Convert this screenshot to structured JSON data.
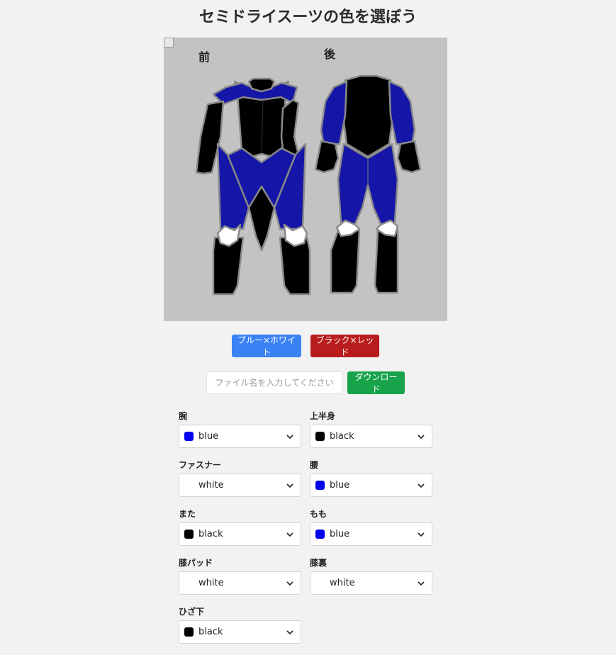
{
  "page": {
    "title": "セミドライスーツの色を選ぼう"
  },
  "figure": {
    "front_label": "前",
    "back_label": "後"
  },
  "presets": [
    {
      "label": "ブルー×ホワイト",
      "color": "#3b82f6"
    },
    {
      "label": "ブラック×レッド",
      "color": "#b91c1c"
    }
  ],
  "download": {
    "placeholder": "ファイル名を入力してください",
    "value": "",
    "button_label": "ダウンロード"
  },
  "colors": {
    "blue": "#0000ee",
    "black": "#000000",
    "white": "#ffffff"
  },
  "parts": [
    {
      "label": "腕",
      "value": "blue"
    },
    {
      "label": "上半身",
      "value": "black"
    },
    {
      "label": "ファスナー",
      "value": "white"
    },
    {
      "label": "腰",
      "value": "blue"
    },
    {
      "label": "また",
      "value": "black"
    },
    {
      "label": "もも",
      "value": "blue"
    },
    {
      "label": "膝パッド",
      "value": "white"
    },
    {
      "label": "膝裏",
      "value": "white"
    },
    {
      "label": "ひざ下",
      "value": "black"
    }
  ]
}
